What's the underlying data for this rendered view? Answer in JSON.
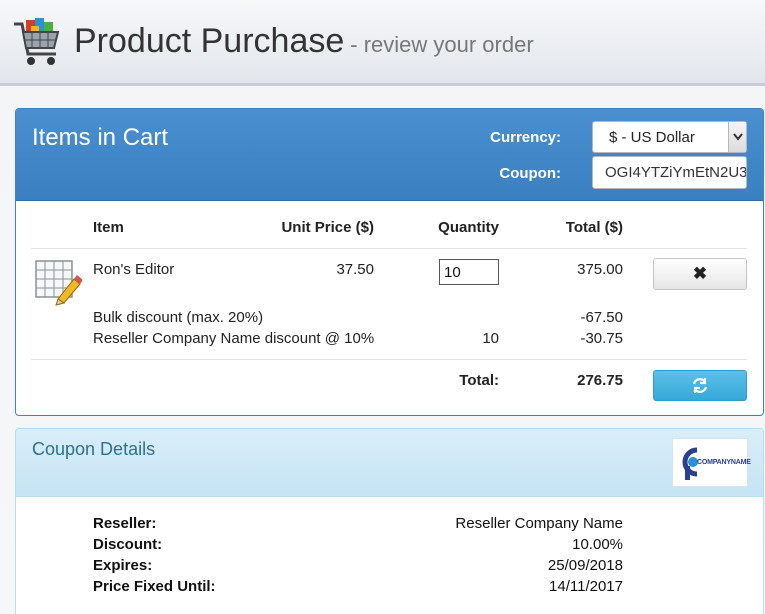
{
  "header": {
    "title": "Product Purchase",
    "subtitle": "- review your order"
  },
  "cart": {
    "title": "Items in Cart",
    "currency_label": "Currency:",
    "currency_value": "$ - US Dollar",
    "coupon_label": "Coupon:",
    "coupon_value": "OGI4YTZiYmEtN2U3",
    "columns": {
      "item": "Item",
      "unit_price": "Unit Price ($)",
      "quantity": "Quantity",
      "total": "Total ($)"
    },
    "line_item": {
      "name": "Ron's Editor",
      "unit_price": "37.50",
      "quantity": "10",
      "total": "375.00"
    },
    "discounts": [
      {
        "label": "Bulk discount (max. 20%)",
        "quantity": "",
        "amount": "-67.50"
      },
      {
        "label": "Reseller Company Name discount @ 10%",
        "quantity": "10",
        "amount": "-30.75"
      }
    ],
    "total_label": "Total:",
    "total_value": "276.75",
    "remove_glyph": "✖"
  },
  "coupon_details": {
    "title": "Coupon Details",
    "logo_text": "COMPANYNAME",
    "rows": [
      {
        "label": "Reseller:",
        "value": "Reseller Company Name"
      },
      {
        "label": "Discount:",
        "value": "10.00%"
      },
      {
        "label": "Expires:",
        "value": "25/09/2018"
      },
      {
        "label": "Price Fixed Until:",
        "value": "14/11/2017"
      }
    ]
  },
  "icons": {
    "header": "shopping-cart-icon",
    "product": "spreadsheet-pencil-icon",
    "remove": "close-icon",
    "refresh": "refresh-icon",
    "dropdown": "chevron-down-icon"
  },
  "colors": {
    "cart_header": "#3f86c8",
    "refresh_button": "#45b3e0",
    "coupon_header": "#cfe9f7",
    "coupon_title": "#31708f"
  }
}
